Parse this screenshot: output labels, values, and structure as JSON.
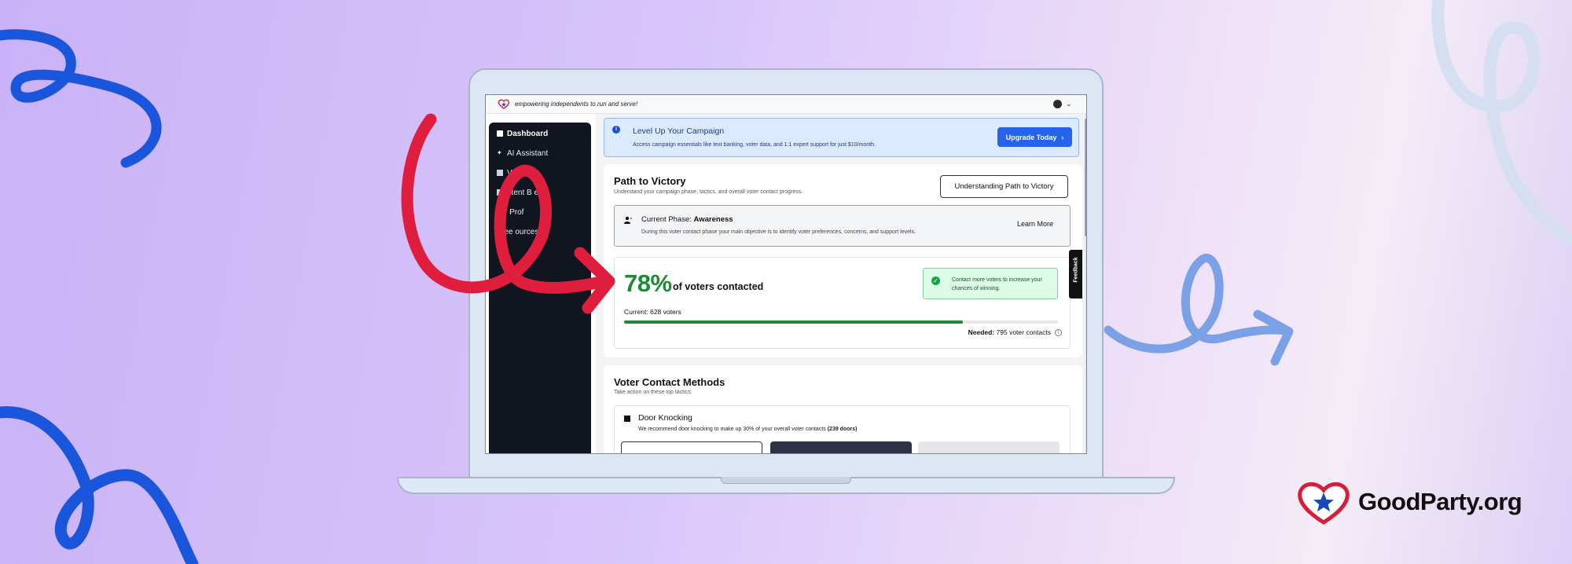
{
  "topbar": {
    "tagline": "empowering independents to run and serve!",
    "logo_icon": "heart-star-icon",
    "avatar_icon": "user-avatar-icon",
    "menu_icon": "chevron-down-icon"
  },
  "sidebar": {
    "items": [
      {
        "label": "Dashboard",
        "icon": "dashboard-icon",
        "active": true
      },
      {
        "label": "AI Assistant",
        "icon": "sparkle-icon",
        "active": false
      },
      {
        "label": "Vot",
        "icon": "folder-icon",
        "active": false
      },
      {
        "label": "ntent B    er",
        "icon": "document-icon",
        "active": false
      },
      {
        "label": "My Prof",
        "icon": "",
        "active": false
      },
      {
        "label": "Free    ources",
        "icon": "",
        "active": false
      }
    ]
  },
  "banner": {
    "title": "Level Up Your Campaign",
    "description": "Access campaign essentials like text banking, voter data, and 1:1 expert support for just $10/month.",
    "button_label": "Upgrade Today",
    "button_icon": "chevron-right-icon"
  },
  "path_to_victory": {
    "title": "Path to Victory",
    "subtitle": "Understand your campaign phase, tactics, and overall voter contact progress.",
    "button_label": "Understanding Path to Victory",
    "phase": {
      "label": "Current Phase:",
      "value": "Awareness",
      "description": "During this voter contact phase your main objective is to identify voter preferences, concerns, and support levels.",
      "link": "Learn More"
    },
    "progress": {
      "percent_text": "78%",
      "percent_value": 78,
      "label": "of voters contacted",
      "tip": "Contact more voters to increase your chances of winning.",
      "current_label": "Current:",
      "current_value": "628 voters",
      "needed_label": "Needed:",
      "needed_value": "795 voter contacts"
    }
  },
  "voter_contact": {
    "title": "Voter Contact Methods",
    "subtitle": "Take action on these top tactics:",
    "method": {
      "title": "Door Knocking",
      "description": "We recommend door knocking to make up 30% of your overall voter contacts",
      "emphasis": "(239 doors)"
    }
  },
  "feedback_tab": "Feedback",
  "brand": {
    "name": "GoodParty.org"
  },
  "colors": {
    "accent_blue": "#2563eb",
    "progress_green": "#1e8a34",
    "sidebar_bg": "#10151f",
    "brand_red": "#d21f3c"
  }
}
